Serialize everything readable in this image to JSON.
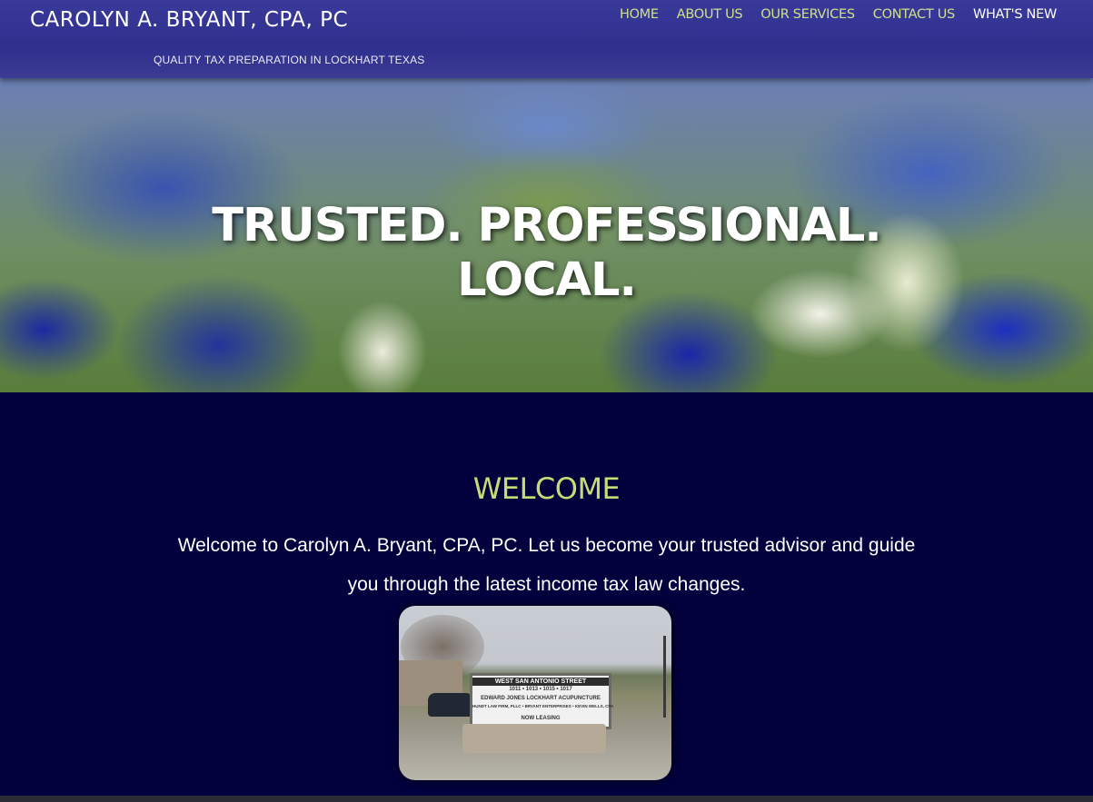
{
  "header": {
    "brand": "CAROLYN A. BRYANT, CPA, PC",
    "tagline": "QUALITY TAX PREPARATION IN LOCKHART TEXAS",
    "nav": [
      {
        "label": "HOME"
      },
      {
        "label": "ABOUT US"
      },
      {
        "label": "OUR SERVICES"
      },
      {
        "label": "CONTACT US"
      },
      {
        "label": "WHAT'S NEW"
      }
    ]
  },
  "hero": {
    "line1": "TRUSTED. PROFESSIONAL.",
    "line2": "LOCAL."
  },
  "welcome": {
    "title": "WELCOME",
    "line1": "Welcome to Carolyn A. Bryant, CPA, PC.  Let us become your trusted advisor and guide",
    "line2": "you through the latest income tax law changes."
  },
  "photo": {
    "sign_header": "WEST SAN ANTONIO STREET",
    "sign_numbers": "1011 • 1013 • 1015 • 1017",
    "sign_tenants_1": "EDWARD JONES    LOCKHART ACUPUNCTURE",
    "sign_tenants_2": "HUNDT LAW FIRM, PLLC • BRYANT ENTERPRISES • KEVIN WELLS, CPA",
    "sign_leasing": "NOW LEASING"
  },
  "colors": {
    "header_bg": "#2f2f8e",
    "page_bg": "#02003d",
    "nav_link": "#cfe08a",
    "welcome_title": "#c7dc74"
  }
}
